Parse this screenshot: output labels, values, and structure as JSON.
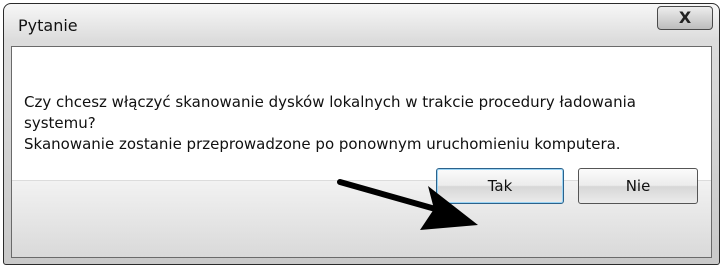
{
  "dialog": {
    "title": "Pytanie",
    "close_label": "X",
    "message_lines": [
      "Czy chcesz włączyć skanowanie dysków lokalnych w trakcie procedury ładowania",
      "systemu?",
      "Skanowanie zostanie przeprowadzone po ponownym uruchomieniu komputera."
    ],
    "buttons": {
      "yes": "Tak",
      "no": "Nie"
    },
    "annotation_arrow": "arrow pointing at Tak button"
  }
}
